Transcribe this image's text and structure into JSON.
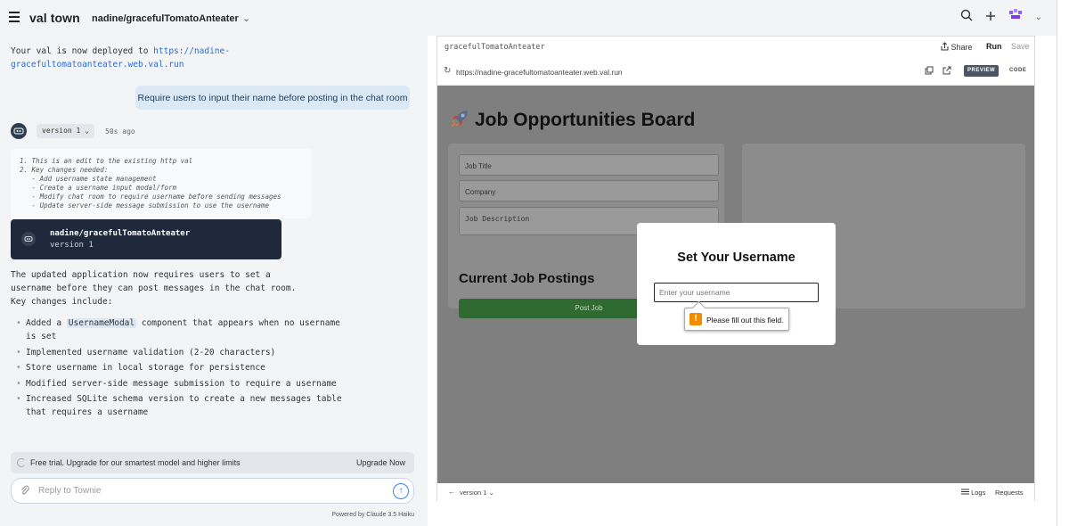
{
  "topbar": {
    "brand": "val town",
    "val_name": "nadine/gracefulTomatoAnteater",
    "chevron": "⌄",
    "icons": [
      "search-icon",
      "plus-icon",
      "avatar-icon",
      "chevron-down-icon"
    ]
  },
  "chat": {
    "deploy_prefix": "Your val is now deployed to ",
    "deploy_url": "https://nadine-gracefultomatoanteater.web.val.run",
    "user_message": "Require users to input their name before posting in the chat room",
    "version_badge": "version 1",
    "time_ago": "50s ago",
    "thinking": "1. This is an edit to the existing http val\n2. Key changes needed:\n   - Add username state management\n   - Create a username input modal/form\n   - Modify chat room to require username before sending messages\n   - Update server-side message submission to use the username",
    "version_card": {
      "title": "nadine/gracefulTomatoAnteater",
      "version": "version 1"
    },
    "updated_text": "The updated application now requires users to set a username before they can post messages in the chat room. Key changes include:",
    "changes": [
      {
        "pre": "Added a ",
        "code": "UsernameModal",
        "post": " component that appears when no username is set"
      },
      {
        "pre": "Implemented username validation (2-20 characters)",
        "code": "",
        "post": ""
      },
      {
        "pre": "Store username in local storage for persistence",
        "code": "",
        "post": ""
      },
      {
        "pre": "Modified server-side message submission to require a username",
        "code": "",
        "post": ""
      },
      {
        "pre": "Increased SQLite schema version to create a new messages table that requires a username",
        "code": "",
        "post": ""
      }
    ],
    "trial_text": "Free trial. Upgrade for our smartest model and higher limits",
    "upgrade_label": "Upgrade Now",
    "reply_placeholder": "Reply to Townie",
    "powered_by": "Powered by Claude 3.5 Haiku"
  },
  "preview": {
    "val_name": "gracefulTomatoAnteater",
    "share_label": "Share",
    "run_label": "Run",
    "save_label": "Save",
    "url": "https://nadine-gracefultomatoanteater.web.val.run",
    "preview_tab": "PREVIEW",
    "code_tab": "CODE",
    "app": {
      "title": "Job Opportunities Board",
      "fields": [
        "Job Title",
        "Company",
        "Job Description"
      ],
      "post_button": "Post Job",
      "current_heading": "Current Job Postings",
      "modal_title": "Set Your Username",
      "modal_placeholder": "Enter your username",
      "validation_message": "Please fill out this field."
    },
    "footer": {
      "version": "version 1",
      "logs_label": "Logs",
      "requests_label": "Requests"
    }
  },
  "colors": {
    "bg_panel": "#f3f4f6",
    "link": "#2a6bd5",
    "user_bubble": "#dbe9f6",
    "card_dark": "#1e293b",
    "post_button": "#2f6b31",
    "warning": "#f08c00"
  }
}
